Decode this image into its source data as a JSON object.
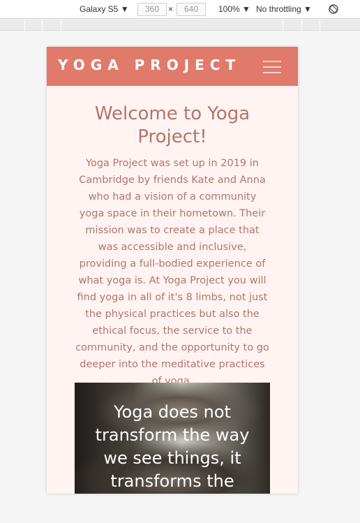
{
  "devtools": {
    "device": "Galaxy S5 ▼",
    "width": "360",
    "times": "×",
    "height": "640",
    "zoom": "100% ▼",
    "throttling": "No throttling ▼",
    "rotate_icon": "rotate-icon"
  },
  "navbar": {
    "brand": "YOGA PROJECT",
    "menu_icon": "hamburger-menu-icon",
    "background": "#e07a6b"
  },
  "main": {
    "heading": "Welcome to Yoga Project!",
    "intro": "Yoga Project was set up in 2019 in Cambridge by friends Kate and Anna who had a vision of a community yoga space in their hometown. Their mission was to create a place that was accessible and inclusive, providing a full-bodied experience of what yoga is. At Yoga Project you will find yoga in all of it's 8 limbs, not just the physical practices but also the ethical focus, the service to the community, and the opportunity to go deeper into the meditative practices of yoga.",
    "quote": "Yoga does not transform the way we see things, it transforms the",
    "text_color": "#b2746d"
  }
}
